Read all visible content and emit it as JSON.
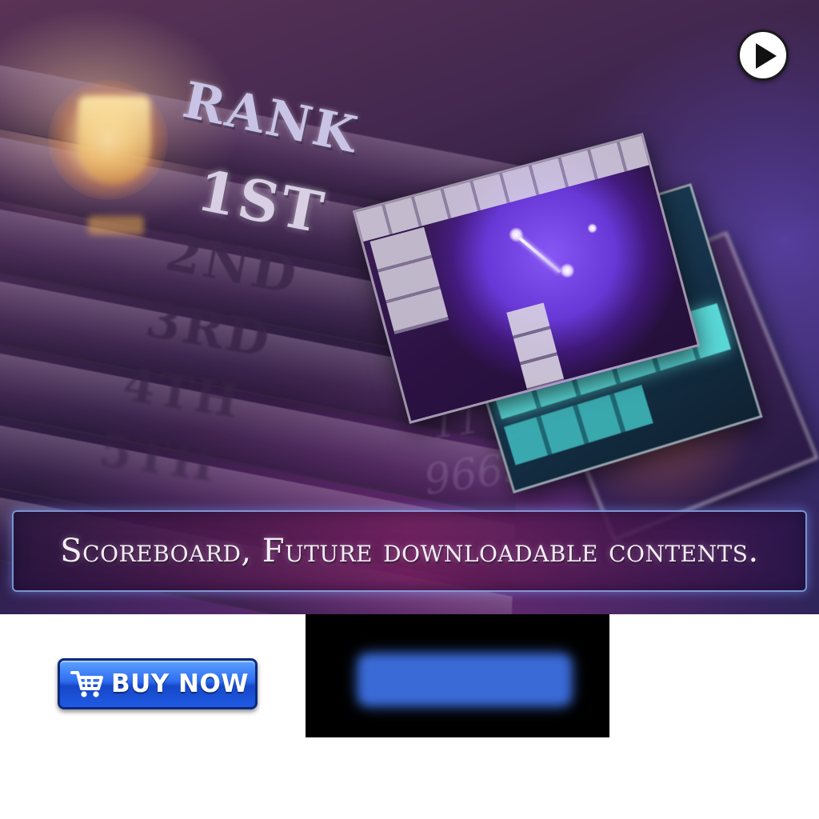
{
  "banner": {
    "scoreboard": {
      "title": "RANK",
      "ranks": [
        "1ST",
        "2ND",
        "3RD",
        "4TH",
        "5TH"
      ],
      "faint_scores": [
        "11",
        "96650"
      ]
    },
    "caption": "Scoreboard, Future downloadable contents.",
    "play_button": {
      "icon": "play-icon"
    }
  },
  "buy_button": {
    "label": "BUY NOW",
    "icon": "cart-icon",
    "color": "#2d6cf0"
  },
  "colors": {
    "banner_purple": "#43284f",
    "caption_border": "#96beff",
    "video_background": "#000000"
  }
}
